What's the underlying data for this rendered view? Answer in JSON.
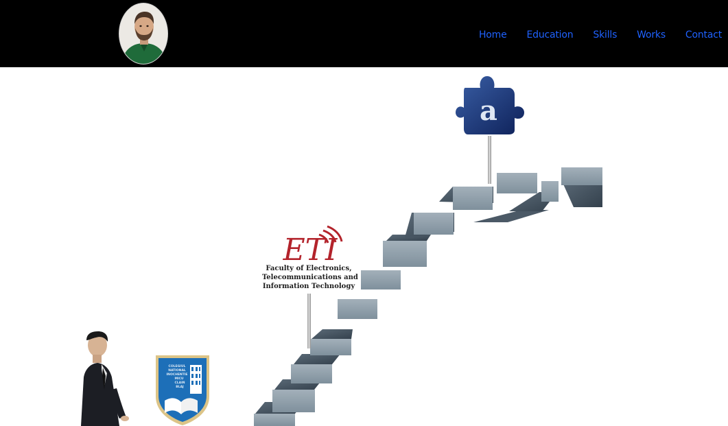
{
  "nav": {
    "avatar_alt": "Profile photo",
    "items": [
      {
        "label": "Home"
      },
      {
        "label": "Education"
      },
      {
        "label": "Skills"
      },
      {
        "label": "Works"
      },
      {
        "label": "Contact"
      }
    ],
    "link_color": "#1f62ff",
    "background": "#000000"
  },
  "hero": {
    "faculty_logo": {
      "letters": "ETI",
      "lines": [
        "Faculty of Electronics,",
        "Telecommunications and",
        "Information Technology"
      ]
    },
    "school_emblem": {
      "lines": [
        "COLEGIUL",
        "NATIONAL",
        "INOCHENTIE",
        "MICU",
        "CLAIN",
        "BLAJ"
      ]
    },
    "puzzle_icon_letter": "a",
    "stair_color": "#8a9aa6"
  }
}
